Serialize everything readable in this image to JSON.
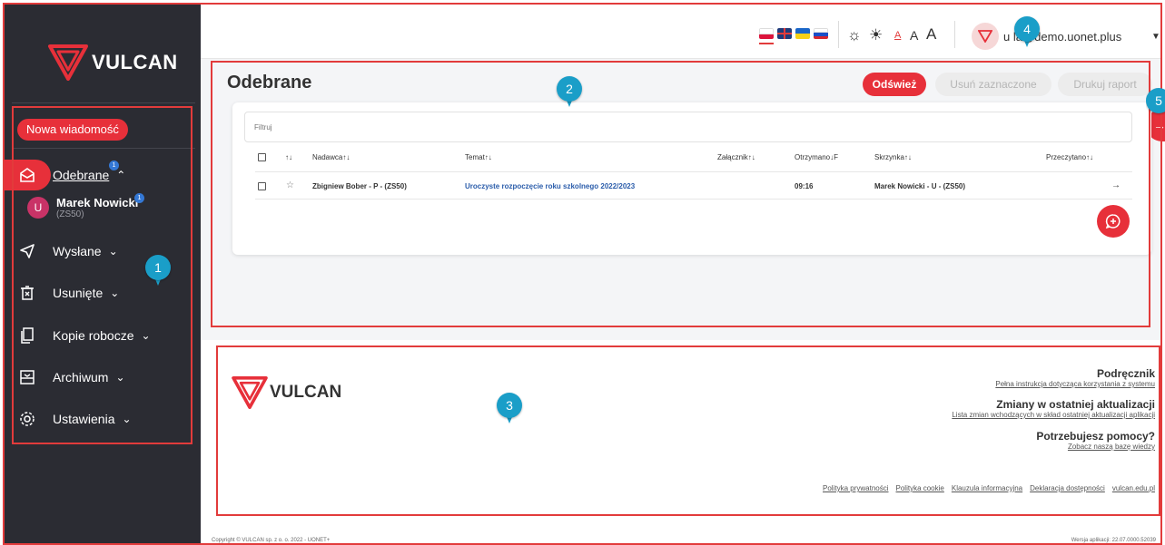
{
  "brand": {
    "name": "VULCAN"
  },
  "sidebar": {
    "new_message_label": "Nowa wiadomość",
    "items": [
      {
        "label": "Odebrane",
        "badge": "1",
        "chevron": "up",
        "active": true,
        "icon": "inbox-icon"
      },
      {
        "label": "Wysłane",
        "chevron": "down",
        "icon": "send-icon"
      },
      {
        "label": "Usunięte",
        "chevron": "down",
        "icon": "trash-icon"
      },
      {
        "label": "Kopie robocze",
        "chevron": "down",
        "icon": "drafts-icon"
      },
      {
        "label": "Archiwum",
        "chevron": "down",
        "icon": "archive-icon"
      },
      {
        "label": "Ustawienia",
        "chevron": "down",
        "icon": "settings-icon"
      }
    ],
    "sub_user": {
      "initial": "U",
      "name": "Marek Nowicki",
      "school": "(ZS50)",
      "badge": "1"
    }
  },
  "topbar": {
    "languages": [
      "pl",
      "en",
      "ua",
      "ru"
    ],
    "font_sizes": [
      "A",
      "A",
      "A"
    ],
    "user_email": "u   la@demo.uonet.plus"
  },
  "main": {
    "title": "Odebrane",
    "buttons": {
      "refresh": "Odśwież",
      "delete_selected": "Usuń zaznaczone",
      "print_report": "Drukuj raport"
    },
    "filter_placeholder": "Filtruj",
    "columns": {
      "sort": "↑↓",
      "sender": "Nadawca↑↓",
      "subject": "Temat↑↓",
      "attachment": "Załącznik↑↓",
      "received": "Otrzymano↓F",
      "mailbox": "Skrzynka↑↓",
      "read": "Przeczytano↑↓"
    },
    "rows": [
      {
        "sender": "Zbigniew Bober - P - (ZS50)",
        "subject": "Uroczyste rozpoczęcie roku szkolnego 2022/2023",
        "received": "09:16",
        "mailbox": "Marek Nowicki - U - (ZS50)",
        "read": "→"
      }
    ]
  },
  "footer": {
    "manual_title": "Podręcznik",
    "manual_link": "Pełna instrukcja dotycząca korzystania z systemu",
    "changes_title": "Zmiany w ostatniej aktualizacji",
    "changes_link": "Lista zmian wchodzących w skład ostatniej aktualizacji aplikacji",
    "help_title": "Potrzebujesz pomocy?",
    "help_link": "Zobacz naszą bazę wiedzy",
    "links": [
      "Polityka prywatności",
      "Polityka cookie",
      "Klauzula informacyjna",
      "Deklaracja dostępności",
      "vulcan.edu.pl"
    ],
    "copyright": "Copyright © VULCAN sp. z o. o. 2022 - UONET+",
    "version": "Wersja aplikacji: 22.07.0000.52039"
  },
  "markers": [
    "1",
    "2",
    "3",
    "4",
    "5"
  ],
  "colors": {
    "accent": "#e7303a",
    "sidebar_bg": "#2b2c33",
    "marker": "#1a9ec8",
    "frame": "#e23b3b"
  }
}
